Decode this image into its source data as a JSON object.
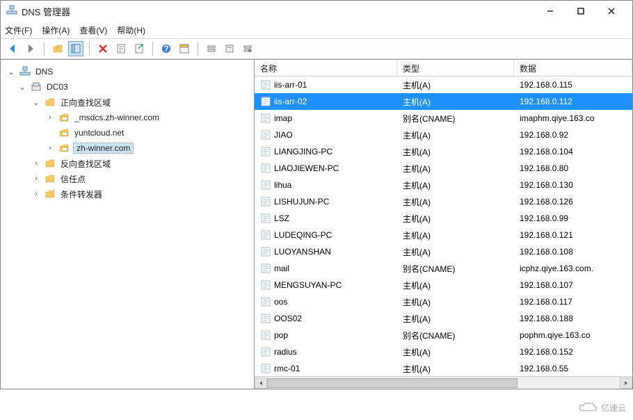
{
  "window": {
    "title": "DNS 管理器"
  },
  "menu": {
    "file": "文件(F)",
    "action": "操作(A)",
    "view": "查看(V)",
    "help": "帮助(H)"
  },
  "tree": {
    "root": "DNS",
    "server": "DC03",
    "fwd_zone": "正向查找区域",
    "zone_msdcs": "_msdcs.zh-winner.com",
    "zone_yunt": "yuntcloud.net",
    "zone_zh": "zh-winner.com",
    "rev_zone": "反向查找区域",
    "trust": "信任点",
    "forwarders": "条件转发器"
  },
  "columns": {
    "name": "名称",
    "type": "类型",
    "data": "数据"
  },
  "records": [
    {
      "name": "iis-arr-01",
      "type": "主机(A)",
      "data": "192.168.0.115"
    },
    {
      "name": "iis-arr-02",
      "type": "主机(A)",
      "data": "192.168.0.112",
      "selected": true
    },
    {
      "name": "imap",
      "type": "别名(CNAME)",
      "data": "imaphm.qiye.163.co"
    },
    {
      "name": "JIAO",
      "type": "主机(A)",
      "data": "192.168.0.92"
    },
    {
      "name": "LIANGJING-PC",
      "type": "主机(A)",
      "data": "192.168.0.104"
    },
    {
      "name": "LIAOJIEWEN-PC",
      "type": "主机(A)",
      "data": "192.168.0.80"
    },
    {
      "name": "lihua",
      "type": "主机(A)",
      "data": "192.168.0.130"
    },
    {
      "name": "LISHUJUN-PC",
      "type": "主机(A)",
      "data": "192.168.0.126"
    },
    {
      "name": "LSZ",
      "type": "主机(A)",
      "data": "192.168.0.99"
    },
    {
      "name": "LUDEQING-PC",
      "type": "主机(A)",
      "data": "192.168.0.121"
    },
    {
      "name": "LUOYANSHAN",
      "type": "主机(A)",
      "data": "192.168.0.108"
    },
    {
      "name": "mail",
      "type": "别名(CNAME)",
      "data": "icphz.qiye.163.com."
    },
    {
      "name": "MENGSUYAN-PC",
      "type": "主机(A)",
      "data": "192.168.0.107"
    },
    {
      "name": "oos",
      "type": "主机(A)",
      "data": "192.168.0.117"
    },
    {
      "name": "OOS02",
      "type": "主机(A)",
      "data": "192.168.0.188"
    },
    {
      "name": "pop",
      "type": "别名(CNAME)",
      "data": "pophm.qiye.163.co"
    },
    {
      "name": "radius",
      "type": "主机(A)",
      "data": "192.168.0.152"
    },
    {
      "name": "rmc-01",
      "type": "主机(A)",
      "data": "192.168.0.55"
    }
  ],
  "watermark": "亿速云"
}
